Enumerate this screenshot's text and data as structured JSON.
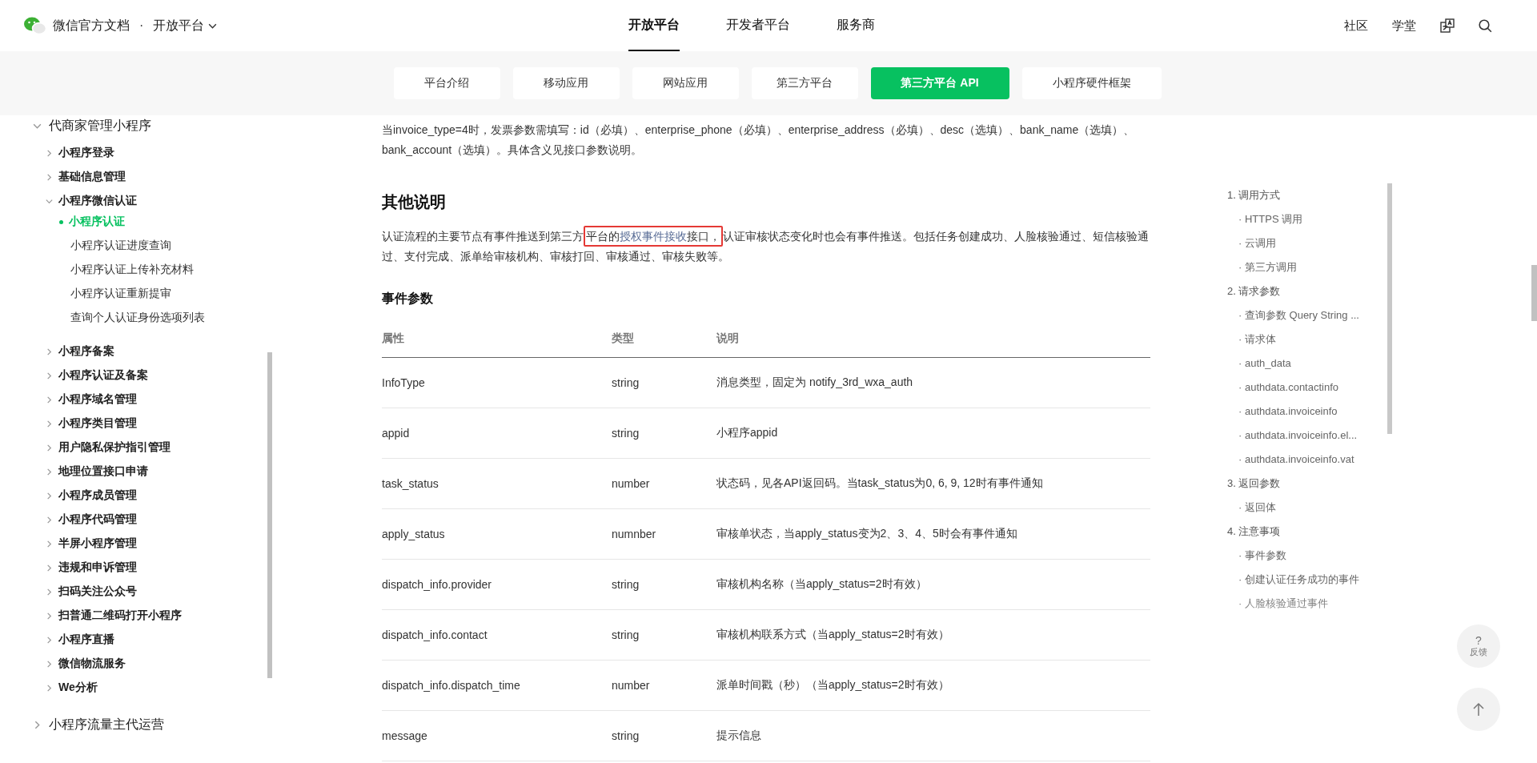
{
  "header": {
    "brand": "微信官方文档",
    "separator": "·",
    "platform": "开放平台",
    "nav": [
      {
        "label": "开放平台",
        "selected": true
      },
      {
        "label": "开发者平台",
        "selected": false
      },
      {
        "label": "服务商",
        "selected": false
      }
    ],
    "links": [
      "社区",
      "学堂"
    ]
  },
  "subnav": [
    {
      "label": "平台介绍",
      "selected": false
    },
    {
      "label": "移动应用",
      "selected": false
    },
    {
      "label": "网站应用",
      "selected": false
    },
    {
      "label": "第三方平台",
      "selected": false
    },
    {
      "label": "第三方平台 API",
      "selected": true
    },
    {
      "label": "小程序硬件框架",
      "selected": false
    }
  ],
  "sidebar": {
    "items": [
      {
        "label": "代商家管理小程序",
        "expanded": true,
        "children": [
          {
            "label": "小程序登录",
            "expanded": false
          },
          {
            "label": "基础信息管理",
            "expanded": false
          },
          {
            "label": "小程序微信认证",
            "expanded": true,
            "children": [
              {
                "label": "小程序认证",
                "selected": true
              },
              {
                "label": "小程序认证进度查询",
                "selected": false
              },
              {
                "label": "小程序认证上传补充材料",
                "selected": false
              },
              {
                "label": "小程序认证重新提审",
                "selected": false
              },
              {
                "label": "查询个人认证身份选项列表",
                "selected": false
              }
            ]
          },
          {
            "label": "小程序备案",
            "expanded": false
          },
          {
            "label": "小程序认证及备案",
            "expanded": false
          },
          {
            "label": "小程序域名管理",
            "expanded": false
          },
          {
            "label": "小程序类目管理",
            "expanded": false
          },
          {
            "label": "用户隐私保护指引管理",
            "expanded": false
          },
          {
            "label": "地理位置接口申请",
            "expanded": false
          },
          {
            "label": "小程序成员管理",
            "expanded": false
          },
          {
            "label": "小程序代码管理",
            "expanded": false
          },
          {
            "label": "半屏小程序管理",
            "expanded": false
          },
          {
            "label": "违规和申诉管理",
            "expanded": false
          },
          {
            "label": "扫码关注公众号",
            "expanded": false
          },
          {
            "label": "扫普通二维码打开小程序",
            "expanded": false
          },
          {
            "label": "小程序直播",
            "expanded": false
          },
          {
            "label": "微信物流服务",
            "expanded": false
          },
          {
            "label": "We分析",
            "expanded": false
          }
        ]
      },
      {
        "label": "小程序流量主代运营",
        "expanded": false
      }
    ]
  },
  "content": {
    "intro": "当invoice_type=4时，发票参数需填写：id（必填）、enterprise_phone（必填）、enterprise_address（必填）、desc（选填）、bank_name（选填）、bank_account（选填）。具体含义见接口参数说明。",
    "heading": "其他说明",
    "note": {
      "before": "认证流程的主要节点有事件推送到第三方",
      "highlight_before": "平台的",
      "link": "授权事件接收",
      "highlight_after": "接口，",
      "after": "认证审核状态变化时也会有事件推送。包括任务创建成功、人脸核验通过、短信核验通过、支付完成、派单给审核机构、审核打回、审核通过、审核失败等。"
    },
    "subheading": "事件参数",
    "table": {
      "columns": [
        "属性",
        "类型",
        "说明"
      ],
      "rows": [
        [
          "InfoType",
          "string",
          "消息类型，固定为 notify_3rd_wxa_auth"
        ],
        [
          "appid",
          "string",
          "小程序appid"
        ],
        [
          "task_status",
          "number",
          "状态码，见各API返回码。当task_status为0, 6, 9, 12时有事件通知"
        ],
        [
          "apply_status",
          "numnber",
          "审核单状态，当apply_status变为2、3、4、5时会有事件通知"
        ],
        [
          "dispatch_info.provider",
          "string",
          "审核机构名称（当apply_status=2时有效）"
        ],
        [
          "dispatch_info.contact",
          "string",
          "审核机构联系方式（当apply_status=2时有效）"
        ],
        [
          "dispatch_info.dispatch_time",
          "number",
          "派单时间戳（秒）（当apply_status=2时有效）"
        ],
        [
          "message",
          "string",
          "提示信息"
        ]
      ]
    }
  },
  "toc": [
    {
      "label": "1. 调用方式",
      "children": [
        "· HTTPS 调用",
        "· 云调用",
        "· 第三方调用"
      ]
    },
    {
      "label": "2. 请求参数",
      "children": [
        "· 查询参数 Query String ...",
        "· 请求体",
        "· auth_data",
        "· authdata.contactinfo",
        "· authdata.invoiceinfo",
        "· authdata.invoiceinfo.el...",
        "· authdata.invoiceinfo.vat"
      ]
    },
    {
      "label": "3. 返回参数",
      "children": [
        "· 返回体"
      ]
    },
    {
      "label": "4. 注意事项",
      "children": [
        "· 事件参数",
        "· 创建认证任务成功的事件",
        "· 人脸核验通过事件"
      ]
    }
  ],
  "float": {
    "feedback_mark": "?",
    "feedback_label": "反馈"
  }
}
